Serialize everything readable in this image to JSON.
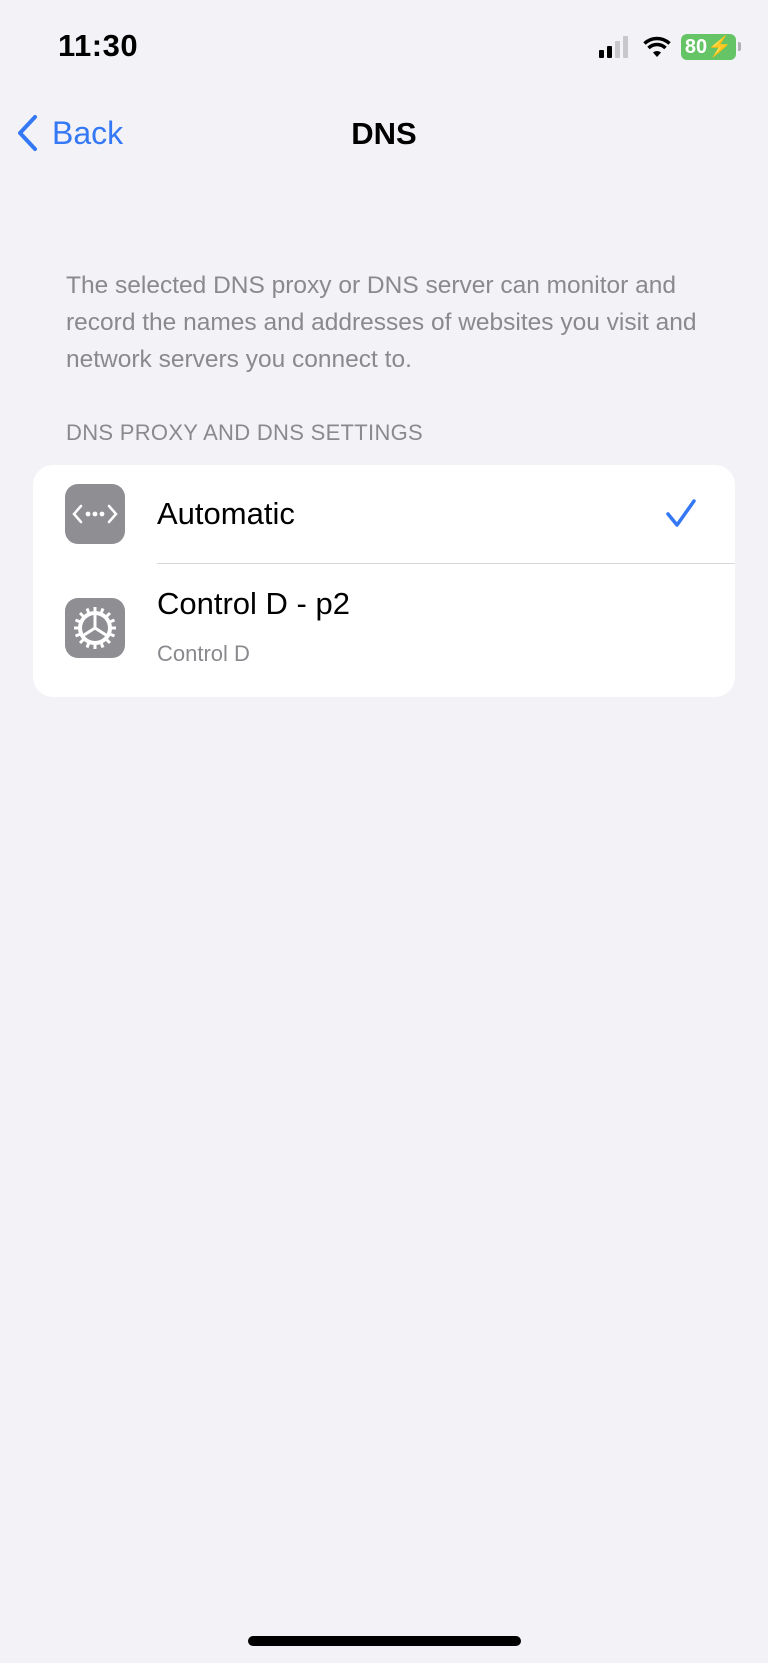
{
  "status_bar": {
    "time": "11:30",
    "battery": "80",
    "icons": [
      "cellular-signal-icon",
      "wifi-icon",
      "battery-charging-icon"
    ],
    "battery_color": "#65c466"
  },
  "nav": {
    "back_label": "Back",
    "title": "DNS",
    "accent": "#3478f6"
  },
  "description": "The selected DNS proxy or DNS server can monitor and record the names and addresses of websites you visit and network servers you connect to.",
  "section_header": "DNS PROXY AND DNS SETTINGS",
  "options": [
    {
      "label": "Automatic",
      "icon": "network-dots-icon",
      "selected": true
    },
    {
      "label": "Control D - p2",
      "subtitle": "Control D",
      "icon": "gear-icon",
      "selected": false
    }
  ]
}
